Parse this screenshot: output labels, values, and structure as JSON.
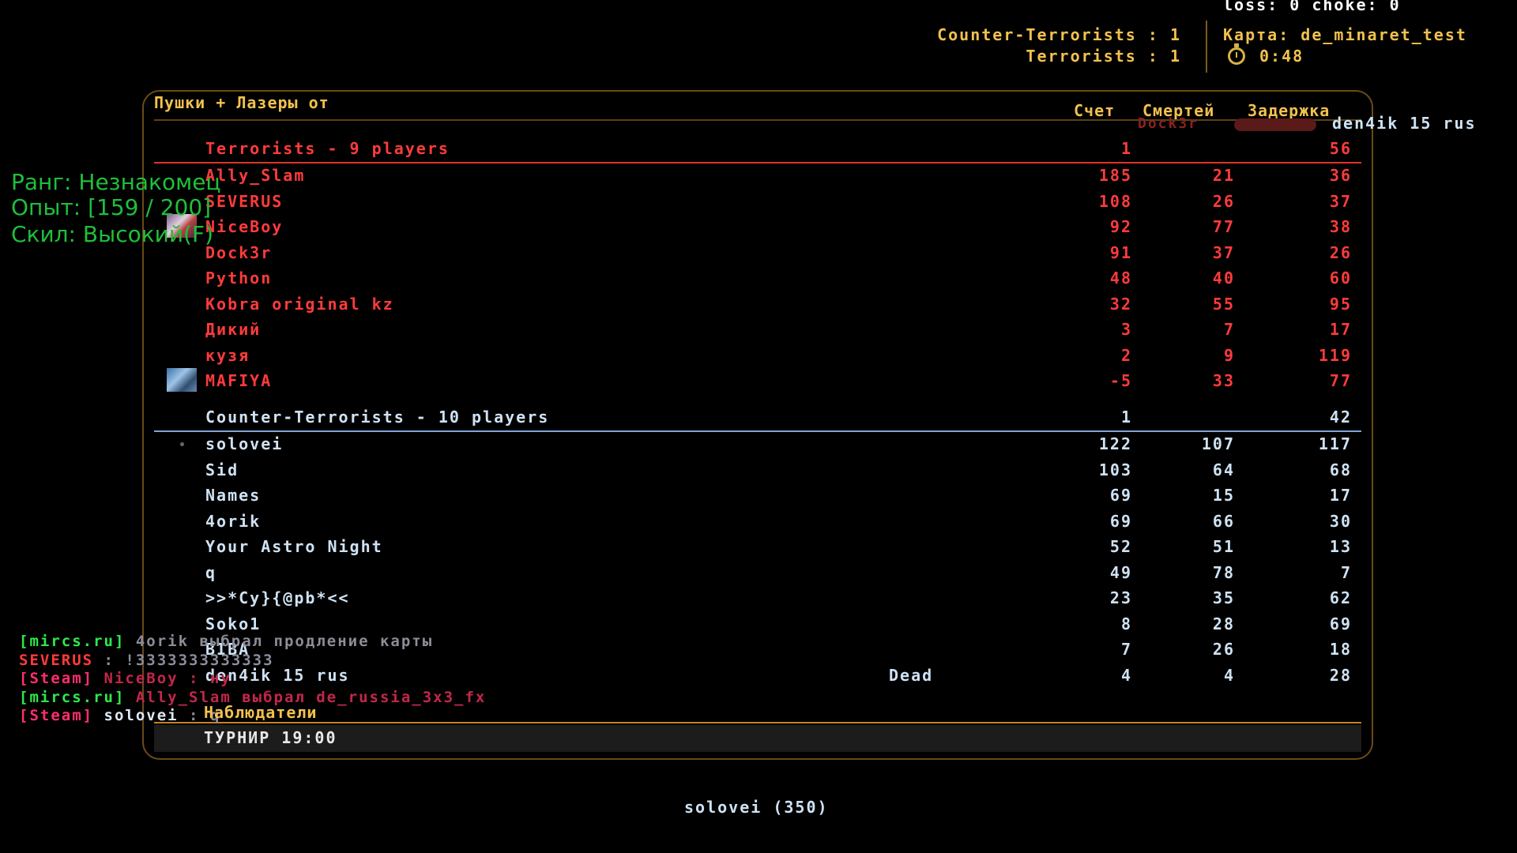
{
  "hud": {
    "netstat": "loss: 0 choke:  0",
    "ct_score": "Counter-Terrorists : 1",
    "t_score": "Terrorists : 1",
    "map": "Карта: de_minaret_test",
    "timer": "0:48",
    "timer_icon": "stopwatch-icon",
    "spectating_ghost": "den4ik 15 rus",
    "ghost_name": "Dock3r"
  },
  "rank_overlay": {
    "rank": "Ранг: Незнакомец",
    "exp": "Опыт: [159 / 200]",
    "skill": "Скил: Высокий(F)"
  },
  "scoreboard": {
    "title": "Пушки + Лазеры от",
    "headers": {
      "score": "Счет",
      "deaths": "Смертей",
      "ping": "Задержка"
    },
    "terrorists": {
      "label": "Terrorists   -   9 players",
      "score": "1",
      "ping": "56",
      "color": "#ff3b3b",
      "players": [
        {
          "name": "Ally_Slam",
          "score": "185",
          "deaths": "21",
          "ping": "36",
          "avatar": ""
        },
        {
          "name": "SEVERUS",
          "score": "108",
          "deaths": "26",
          "ping": "37",
          "avatar": ""
        },
        {
          "name": "NiceBoy",
          "score": "92",
          "deaths": "77",
          "ping": "38",
          "avatar": "avatar-a"
        },
        {
          "name": "Dock3r",
          "score": "91",
          "deaths": "37",
          "ping": "26",
          "avatar": ""
        },
        {
          "name": "Python",
          "score": "48",
          "deaths": "40",
          "ping": "60",
          "avatar": ""
        },
        {
          "name": "Kobra original kz",
          "score": "32",
          "deaths": "55",
          "ping": "95",
          "avatar": ""
        },
        {
          "name": "Дикий",
          "score": "3",
          "deaths": "7",
          "ping": "17",
          "avatar": ""
        },
        {
          "name": "кузя",
          "score": "2",
          "deaths": "9",
          "ping": "119",
          "avatar": ""
        },
        {
          "name": "MAFIYA",
          "score": "-5",
          "deaths": "33",
          "ping": "77",
          "avatar": "avatar-b"
        }
      ]
    },
    "counter_terrorists": {
      "label": "Counter-Terrorists   -   10 players",
      "score": "1",
      "ping": "42",
      "color": "#cfe2f3",
      "players": [
        {
          "name": "solovei",
          "score": "122",
          "deaths": "107",
          "ping": "117",
          "status": "",
          "marker": "dot"
        },
        {
          "name": "Sid",
          "score": "103",
          "deaths": "64",
          "ping": "68",
          "status": ""
        },
        {
          "name": "Names",
          "score": "69",
          "deaths": "15",
          "ping": "17",
          "status": ""
        },
        {
          "name": "4orik",
          "score": "69",
          "deaths": "66",
          "ping": "30",
          "status": ""
        },
        {
          "name": "Your Astro Night",
          "score": "52",
          "deaths": "51",
          "ping": "13",
          "status": ""
        },
        {
          "name": "q",
          "score": "49",
          "deaths": "78",
          "ping": "7",
          "status": ""
        },
        {
          "name": ">>*Cy}{@pb*<<",
          "score": "23",
          "deaths": "35",
          "ping": "62",
          "status": ""
        },
        {
          "name": "Soko1",
          "score": "8",
          "deaths": "28",
          "ping": "69",
          "status": ""
        },
        {
          "name": "BIBA",
          "score": "7",
          "deaths": "26",
          "ping": "18",
          "status": ""
        },
        {
          "name": "den4ik 15 rus",
          "score": "4",
          "deaths": "4",
          "ping": "28",
          "status": "Dead"
        }
      ]
    },
    "spectators_label": "Наблюдатели",
    "footer": "ТУРНИР 19:00"
  },
  "chat": [
    {
      "tag": "[mircs.ru]",
      "name": "4orik",
      "text": "выбрал продление карты"
    },
    {
      "tag": "",
      "name": "SEVERUS",
      "text": ": !3333333333333"
    },
    {
      "tag": "[Steam]",
      "name": "NiceBoy",
      "text": ": ну"
    },
    {
      "tag": "[mircs.ru]",
      "name": "Ally_Slam",
      "text": "выбрал de_russia_3x3_fx"
    },
    {
      "tag": "[Steam]",
      "name": "solovei",
      "text": ": q"
    }
  ],
  "spectate_target": "solovei (350)"
}
